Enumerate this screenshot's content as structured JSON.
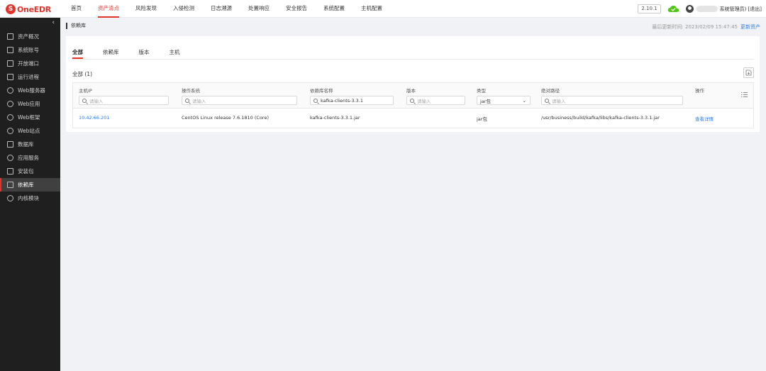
{
  "header": {
    "logo_text": "OneEDR",
    "nav": [
      {
        "label": "首页",
        "active": false
      },
      {
        "label": "资产清点",
        "active": true
      },
      {
        "label": "风险发现",
        "active": false
      },
      {
        "label": "入侵检测",
        "active": false
      },
      {
        "label": "日志溯源",
        "active": false
      },
      {
        "label": "处置响应",
        "active": false
      },
      {
        "label": "安全报告",
        "active": false
      },
      {
        "label": "系统配置",
        "active": false
      },
      {
        "label": "主机配置",
        "active": false
      }
    ],
    "version": "2.10.1",
    "user_label": "系统管理员) [退出]"
  },
  "sidebar": {
    "collapse_icon": "‹",
    "items": [
      {
        "label": "资产概况",
        "icon": "overview-icon",
        "active": false
      },
      {
        "label": "系统账号",
        "icon": "account-icon",
        "active": false
      },
      {
        "label": "开放端口",
        "icon": "port-icon",
        "active": false
      },
      {
        "label": "运行进程",
        "icon": "process-icon",
        "active": false
      },
      {
        "label": "Web服务器",
        "icon": "web-server-icon",
        "active": false
      },
      {
        "label": "Web应用",
        "icon": "web-app-icon",
        "active": false
      },
      {
        "label": "Web框架",
        "icon": "web-framework-icon",
        "active": false
      },
      {
        "label": "Web站点",
        "icon": "web-site-icon",
        "active": false
      },
      {
        "label": "数据库",
        "icon": "database-icon",
        "active": false
      },
      {
        "label": "应用服务",
        "icon": "app-service-icon",
        "active": false
      },
      {
        "label": "安装包",
        "icon": "package-icon",
        "active": false
      },
      {
        "label": "依赖库",
        "icon": "dependency-icon",
        "active": true
      },
      {
        "label": "内核模块",
        "icon": "kernel-module-icon",
        "active": false
      }
    ]
  },
  "page": {
    "breadcrumb": "依赖库",
    "updated_label": "最后更新时间: 2023/02/09 15:47:45",
    "update_link": "更新资产",
    "tabs": [
      "全部",
      "依赖库",
      "版本",
      "主机"
    ],
    "count_label": "全部 (1)"
  },
  "table": {
    "columns": [
      {
        "label": "主机IP",
        "filter": "请输入",
        "filled": false
      },
      {
        "label": "操作系统",
        "filter": "请输入",
        "filled": false
      },
      {
        "label": "依赖库名称",
        "filter": "kafka-clients-3.3.1",
        "filled": true
      },
      {
        "label": "版本",
        "filter": "请输入",
        "filled": false
      },
      {
        "label": "类型",
        "filter": "jar包",
        "filled": true
      },
      {
        "label": "绝对路径",
        "filter": "请输入",
        "filled": false
      },
      {
        "label": "操作",
        "filter": "",
        "filled": false
      }
    ],
    "rows": [
      {
        "host_ip": "10.42.66.201",
        "os": "CentOS Linux release 7.6.1810 (Core)",
        "name": "kafka-clients-3.3.1.jar",
        "version": "",
        "type": "jar包",
        "path": "/usr/business/build/kafka/libs/kafka-clients-3.3.1.jar",
        "action": "查看详情"
      }
    ]
  },
  "colors": {
    "accent": "#e0342c",
    "link": "#2f7ee6",
    "sidebar_bg": "#1f1f1f",
    "cloud_ok": "#52c41a"
  }
}
